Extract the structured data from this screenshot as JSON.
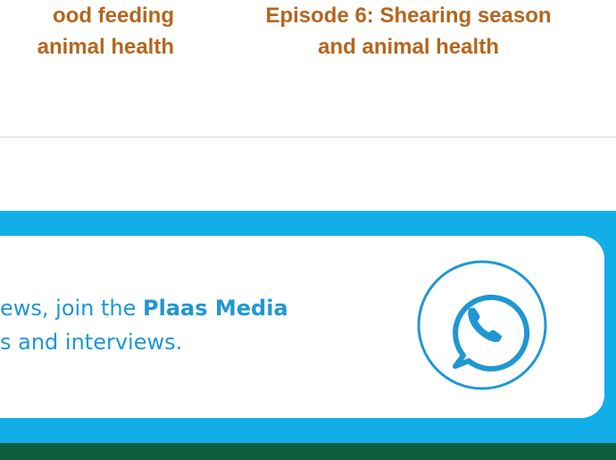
{
  "episodes": [
    {
      "title_line1": "ood feeding",
      "title_line2": "animal health"
    },
    {
      "title_line1": "Episode 6: Shearing season",
      "title_line2": "and animal health"
    }
  ],
  "whatsapp_banner": {
    "text_line1_start": "ews, join the ",
    "brand": "Plaas Media",
    "text_line2": "s and interviews.",
    "icon": "whatsapp-icon"
  },
  "colors": {
    "episode_title": "#b5651d",
    "banner_background": "#12aee8",
    "banner_text": "#1f97d4",
    "footer": "#0b5f3e"
  }
}
